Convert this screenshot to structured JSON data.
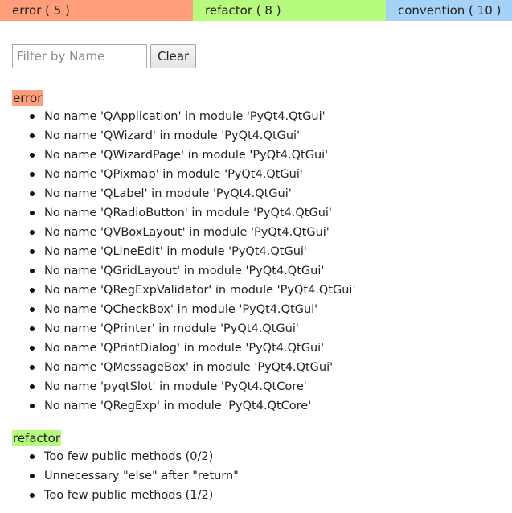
{
  "tabs": [
    {
      "label": "error ( 5 )",
      "color": "#fe9e7a"
    },
    {
      "label": "refactor ( 8 )",
      "color": "#b7fb7e"
    },
    {
      "label": "convention ( 10 )",
      "color": "#a6d2f8"
    }
  ],
  "filter": {
    "placeholder": "Filter by Name",
    "value": "",
    "clear_label": "Clear"
  },
  "sections": {
    "error": {
      "label": "error",
      "color": "#fe9e7a",
      "items": [
        "No name 'QApplication' in module 'PyQt4.QtGui'",
        "No name 'QWizard' in module 'PyQt4.QtGui'",
        "No name 'QWizardPage' in module 'PyQt4.QtGui'",
        "No name 'QPixmap' in module 'PyQt4.QtGui'",
        "No name 'QLabel' in module 'PyQt4.QtGui'",
        "No name 'QRadioButton' in module 'PyQt4.QtGui'",
        "No name 'QVBoxLayout' in module 'PyQt4.QtGui'",
        "No name 'QLineEdit' in module 'PyQt4.QtGui'",
        "No name 'QGridLayout' in module 'PyQt4.QtGui'",
        "No name 'QRegExpValidator' in module 'PyQt4.QtGui'",
        "No name 'QCheckBox' in module 'PyQt4.QtGui'",
        "No name 'QPrinter' in module 'PyQt4.QtGui'",
        "No name 'QPrintDialog' in module 'PyQt4.QtGui'",
        "No name 'QMessageBox' in module 'PyQt4.QtGui'",
        "No name 'pyqtSlot' in module 'PyQt4.QtCore'",
        "No name 'QRegExp' in module 'PyQt4.QtCore'"
      ]
    },
    "refactor": {
      "label": "refactor",
      "color": "#b7fb7e",
      "items": [
        "Too few public methods (0/2)",
        "Unnecessary \"else\" after \"return\"",
        "Too few public methods (1/2)"
      ]
    }
  }
}
